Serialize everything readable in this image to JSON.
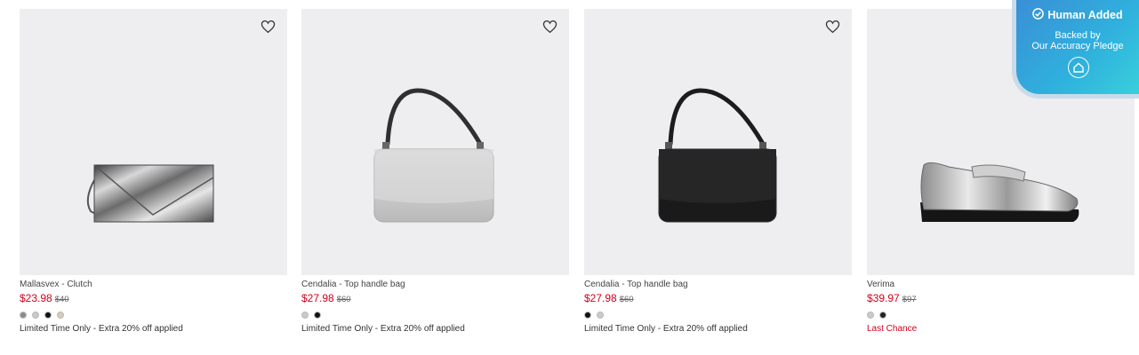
{
  "products": [
    {
      "name": "Mallasvex - Clutch",
      "price": "$23.98",
      "was_price": "$40",
      "swatches": [
        "#8a8a8a",
        "#c9c9c9",
        "#111111",
        "#d8cbb5"
      ],
      "promo": "Limited Time Only - Extra 20% off applied",
      "promo_color": "#333333"
    },
    {
      "name": "Cendalia - Top handle bag",
      "price": "$27.98",
      "was_price": "$60",
      "swatches": [
        "#c9c9c9",
        "#111111"
      ],
      "promo": "Limited Time Only - Extra 20% off applied",
      "promo_color": "#333333"
    },
    {
      "name": "Cendalia - Top handle bag",
      "price": "$27.98",
      "was_price": "$60",
      "swatches": [
        "#111111",
        "#c9c9c9"
      ],
      "promo": "Limited Time Only - Extra 20% off applied",
      "promo_color": "#333333"
    },
    {
      "name": "Verima",
      "price": "$39.97",
      "was_price": "$97",
      "swatches": [
        "#c9c9c9",
        "#222222"
      ],
      "promo": "Last Chance",
      "promo_color": "#d0021b"
    }
  ],
  "icons": {
    "favorite": "heart-outline-icon",
    "badge_check": "check-circle-icon",
    "badge_home": "home-icon"
  },
  "badge": {
    "title": "Human Added",
    "line1": "Backed by",
    "line2": "Our Accuracy Pledge"
  },
  "colors": {
    "sale_price": "#d0021b",
    "image_bg": "#eeedf0",
    "badge_start": "#3a8fd6",
    "badge_end": "#39d3dc"
  }
}
